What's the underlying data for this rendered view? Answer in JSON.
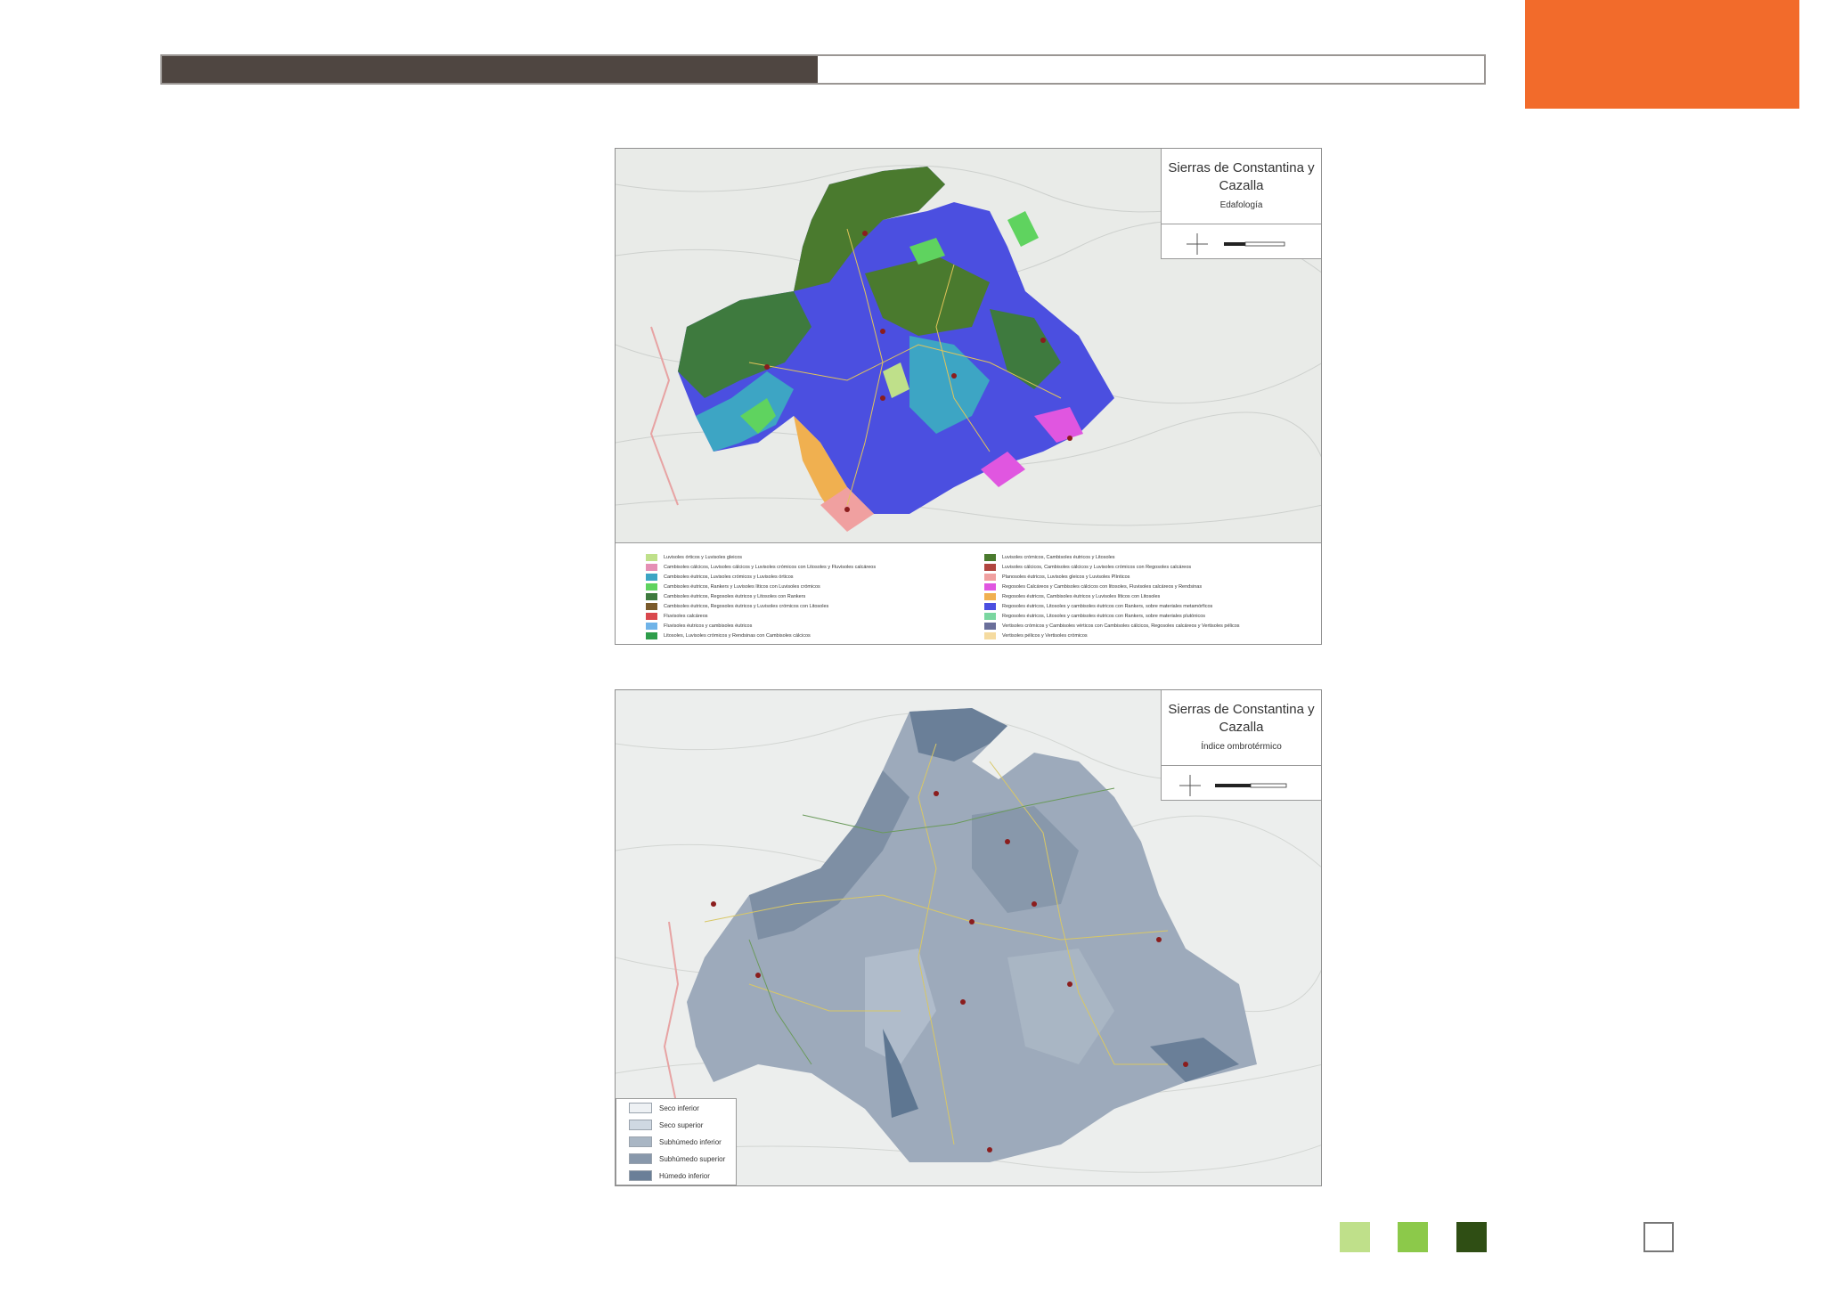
{
  "colors": {
    "header_fill": "#4f4641",
    "orange_tab": "#f26b2b",
    "squares": [
      "#bfe08a",
      "#8cc94a",
      "#2f4e14"
    ]
  },
  "header": {
    "progress": 0.496
  },
  "map1": {
    "title": "Sierras de Constantina y Cazalla",
    "subtitle": "Edafología",
    "legend_left": [
      {
        "label": "Luvisoles órticos y Luvisoles gleicos",
        "color": "#bfe08a"
      },
      {
        "label": "Cambisoles cálcicos, Luvisoles cálcicos y Luvisoles crómicos con Litosoles y Fluvisoles calcáreos",
        "color": "#e58fb5"
      },
      {
        "label": "Cambisoles éutricos, Luvisoles crómicos y Luvisoles órticos",
        "color": "#3da5c4"
      },
      {
        "label": "Cambisoles éutricos, Rankers y Luvisoles líticos con Luvisoles crómicos",
        "color": "#5fd35f"
      },
      {
        "label": "Cambisoles éutricos, Regosoles éutricos y Litosoles con Rankers",
        "color": "#3e7a3e"
      },
      {
        "label": "Cambisoles éutricos, Regosoles éutricos y Luvisoles crómicos con Litosoles",
        "color": "#7a5a2b"
      },
      {
        "label": "Fluvisoles calcáreos",
        "color": "#d9484d"
      },
      {
        "label": "Fluvisoles éutricos y cambisoles éutricos",
        "color": "#6fb3e8"
      },
      {
        "label": "Litosoles, Luvisoles crómicos y Rendsinas con Cambisoles cálcicos",
        "color": "#2e9d4a"
      }
    ],
    "legend_right": [
      {
        "label": "Luvisoles crómicos, Cambisoles éutricos y Litosoles",
        "color": "#4a7a2e"
      },
      {
        "label": "Luvisoles cálcicos, Cambisoles cálcicos y Luvisoles crómicos con Regosoles calcáreos",
        "color": "#b0453f"
      },
      {
        "label": "Planosoles éutricos, Luvisoles gleicos y Luvisoles Plínticos",
        "color": "#f0a0a0"
      },
      {
        "label": "Regosoles Calcáreos y Cambisoles cálcicos con litosoles, Fluvisoles calcáreos y Rendsinas",
        "color": "#e056e0"
      },
      {
        "label": "Regosoles éutricos, Cambisoles éutricos y Luvisoles líticos con Litosoles",
        "color": "#f0b050"
      },
      {
        "label": "Regosoles éutricos, Litosoles y cambisoles éutricos con Rankers, sobre materiales metamórficos",
        "color": "#4b4fe0"
      },
      {
        "label": "Regosoles éutricos, Litosoles y cambisoles éutricos con Rankers, sobre materiales plutónicos",
        "color": "#7ad6a0"
      },
      {
        "label": "Vertisoles crómicos y Cambisoles vérticos con Cambisoles cálcicos, Regosoles calcáreos y Vertisoles pélicos",
        "color": "#6a6f9a"
      },
      {
        "label": "Vertisoles pélicos y Vertisoles crómicos",
        "color": "#f5dba0"
      }
    ]
  },
  "map2": {
    "title": "Sierras de Constantina y Cazalla",
    "subtitle": "Índice ombrotérmico",
    "legend": [
      {
        "label": "Seco inferior",
        "color": "#eef1f4"
      },
      {
        "label": "Seco superior",
        "color": "#cfd8e2"
      },
      {
        "label": "Subhúmedo inferior",
        "color": "#a9b6c4"
      },
      {
        "label": "Subhúmedo superior",
        "color": "#8898ab"
      },
      {
        "label": "Húmedo inferior",
        "color": "#6a7f98"
      }
    ]
  }
}
